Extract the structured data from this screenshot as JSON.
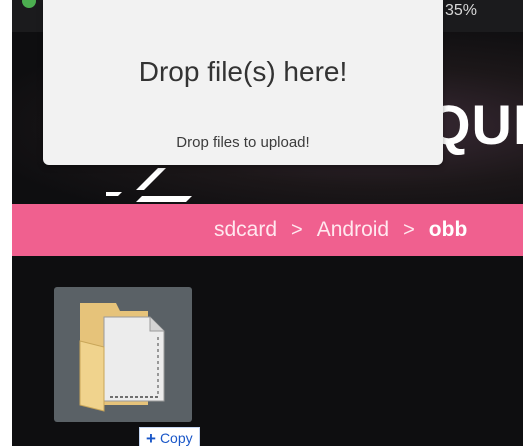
{
  "statusbar": {
    "battery_text": "35%",
    "icons": [
      "status-dot",
      "battery-charging-icon"
    ]
  },
  "banner": {
    "brand_partial": "QUE"
  },
  "breadcrumb": {
    "items": [
      "sdcard",
      "Android",
      "obb"
    ],
    "separator": ">"
  },
  "files": [
    {
      "type": "folder",
      "icon": "folder-icon"
    }
  ],
  "drag_tag": {
    "label": "Copy",
    "icon": "plus-icon"
  },
  "drop_overlay": {
    "title": "Drop file(s) here!",
    "subtitle": "Drop files to upload!"
  },
  "colors": {
    "accent": "#f0608f",
    "background": "#0e0e10",
    "overlay": "#f2f2f2",
    "folder_tile": "#5a6166",
    "copy_text": "#1a57c8"
  }
}
